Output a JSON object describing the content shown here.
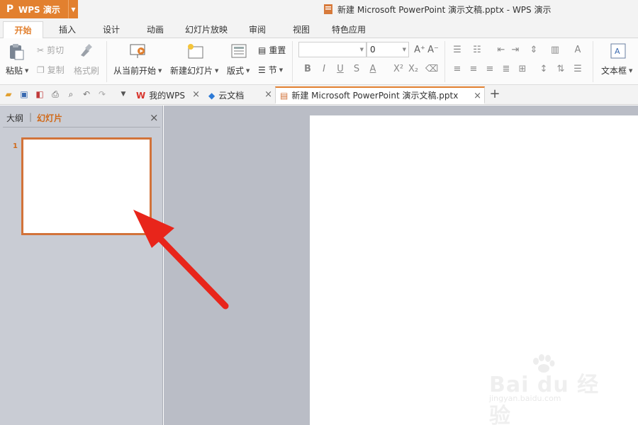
{
  "app": {
    "logo": "P",
    "name": "WPS 演示",
    "window_title": "新建 Microsoft PowerPoint 演示文稿.pptx - WPS 演示",
    "accent": "#e2802f"
  },
  "menu": {
    "tabs": [
      "开始",
      "插入",
      "设计",
      "动画",
      "幻灯片放映",
      "审阅",
      "视图",
      "特色应用"
    ],
    "active": "开始"
  },
  "ribbon": {
    "paste": "粘贴",
    "cut": "剪切",
    "copy": "复制",
    "format_painter": "格式刷",
    "from_current": "从当前开始",
    "new_slide": "新建幻灯片",
    "layout": "版式",
    "reset": "重置",
    "section": "节",
    "font_size_value": "0",
    "text_box": "文本框",
    "font_buttons": [
      "B",
      "I",
      "U",
      "S",
      "A"
    ]
  },
  "doc_tabs": [
    {
      "label": "我的WPS",
      "icon": "wps-icon"
    },
    {
      "label": "云文档",
      "icon": "cloud-cube-icon"
    },
    {
      "label": "新建 Microsoft PowerPoint 演示文稿.pptx",
      "icon": "pptx-file-icon",
      "active": true
    }
  ],
  "left_pane": {
    "tab_outline": "大纲",
    "divider": "|",
    "tab_slides": "幻灯片",
    "slide_number": "1"
  },
  "watermark": {
    "logo_text": "Bai du 经验",
    "url": "jingyan.baidu.com"
  }
}
